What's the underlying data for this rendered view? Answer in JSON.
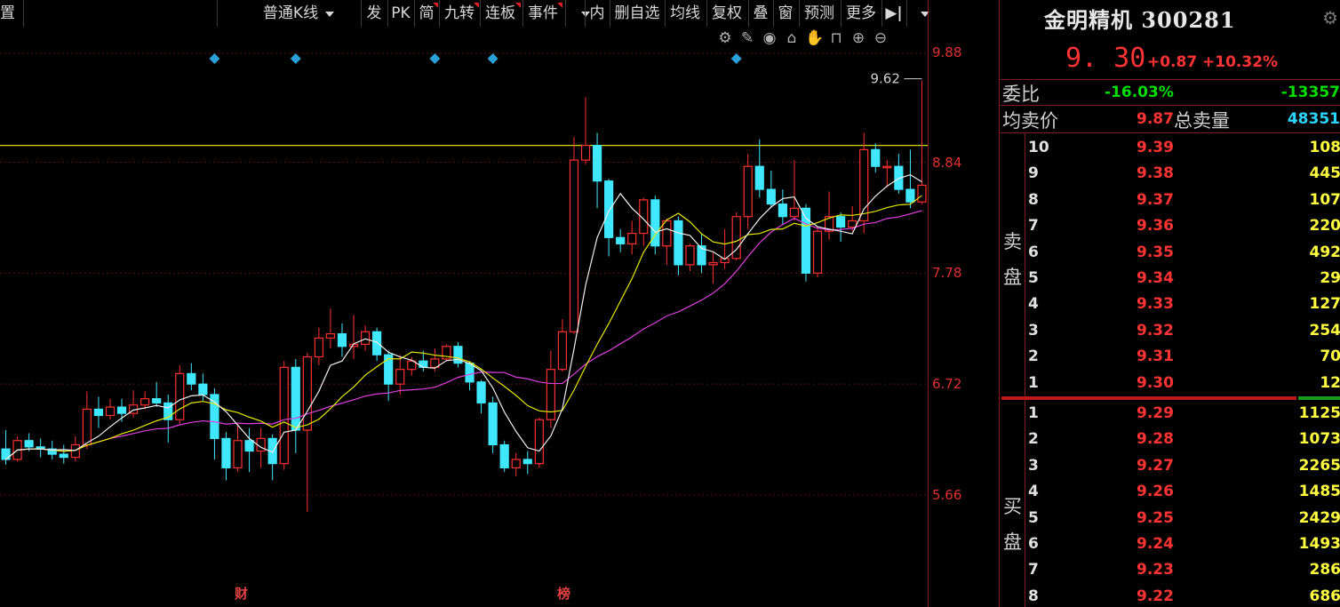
{
  "toolbar": {
    "left_cut": "置",
    "kline_type": "普通K线",
    "items": [
      "发",
      "PK",
      "简",
      "九转",
      "连板",
      "事件",
      "内",
      "删自选",
      "均线",
      "复权",
      "叠",
      "窗",
      "预测",
      "更多"
    ],
    "end_icon": "▶|"
  },
  "chart_icons": [
    "gear-icon",
    "pen-icon",
    "eye-icon",
    "lock-open-icon",
    "hand-icon",
    "lock-icon",
    "zoom-in-icon",
    "zoom-out-icon"
  ],
  "price_axis": {
    "ticks": [
      "9.88",
      "8.84",
      "7.78",
      "6.72",
      "5.66"
    ]
  },
  "x_markers": [
    {
      "label": "财"
    },
    {
      "label": "榜"
    }
  ],
  "stock": {
    "name_code": "金明精机 300281",
    "price": "9. 30",
    "change": "+0.87",
    "change_pct": "+10.32%"
  },
  "summary": {
    "weibi_label": "委比",
    "weibi_pct": "-16.03%",
    "weibi_diff": "-13357",
    "avg_sell_label": "均卖价",
    "avg_sell_price": "9.87",
    "total_sell_label": "总卖量",
    "total_sell_vol": "48351"
  },
  "sell_label": "卖盘",
  "buy_label": "买盘",
  "sell_book": [
    {
      "level": "10",
      "price": "9.39",
      "vol": "108"
    },
    {
      "level": "9",
      "price": "9.38",
      "vol": "445"
    },
    {
      "level": "8",
      "price": "9.37",
      "vol": "107"
    },
    {
      "level": "7",
      "price": "9.36",
      "vol": "220"
    },
    {
      "level": "6",
      "price": "9.35",
      "vol": "492"
    },
    {
      "level": "5",
      "price": "9.34",
      "vol": "29"
    },
    {
      "level": "4",
      "price": "9.33",
      "vol": "127"
    },
    {
      "level": "3",
      "price": "9.32",
      "vol": "254"
    },
    {
      "level": "2",
      "price": "9.31",
      "vol": "70"
    },
    {
      "level": "1",
      "price": "9.30",
      "vol": "12"
    }
  ],
  "buy_book": [
    {
      "level": "1",
      "price": "9.29",
      "vol": "1125"
    },
    {
      "level": "2",
      "price": "9.28",
      "vol": "1073"
    },
    {
      "level": "3",
      "price": "9.27",
      "vol": "2265"
    },
    {
      "level": "4",
      "price": "9.26",
      "vol": "1485"
    },
    {
      "level": "5",
      "price": "9.25",
      "vol": "2429"
    },
    {
      "level": "6",
      "price": "9.24",
      "vol": "1493"
    },
    {
      "level": "7",
      "price": "9.23",
      "vol": "286"
    },
    {
      "level": "8",
      "price": "9.22",
      "vol": "686"
    }
  ],
  "chart_data": {
    "type": "candlestick",
    "y_ticks": [
      9.88,
      8.84,
      7.78,
      6.72,
      5.66
    ],
    "ylim": [
      4.6,
      10.2
    ],
    "high_label": "9.62",
    "reference_line": 9.0,
    "colors": {
      "up": "#ff3030",
      "down": "#40e8ff",
      "ma5": "#f0f0f0",
      "ma10": "#e8e800",
      "ma20": "#e040e0",
      "ref": "#d8d800",
      "event": "#2aa0d8"
    },
    "event_marker_candles": [
      18,
      25,
      37,
      42,
      63
    ],
    "candles": [
      [
        6.1,
        6.0,
        6.28,
        5.95
      ],
      [
        6.0,
        6.18,
        6.22,
        5.98
      ],
      [
        6.18,
        6.12,
        6.25,
        6.08
      ],
      [
        6.12,
        6.1,
        6.2,
        6.02
      ],
      [
        6.1,
        6.05,
        6.18,
        6.0
      ],
      [
        6.05,
        6.02,
        6.14,
        5.96
      ],
      [
        6.02,
        6.14,
        6.22,
        5.98
      ],
      [
        6.14,
        6.48,
        6.65,
        6.1
      ],
      [
        6.48,
        6.42,
        6.6,
        6.3
      ],
      [
        6.42,
        6.5,
        6.58,
        6.38
      ],
      [
        6.5,
        6.44,
        6.58,
        6.36
      ],
      [
        6.44,
        6.52,
        6.66,
        6.4
      ],
      [
        6.52,
        6.58,
        6.65,
        6.48
      ],
      [
        6.58,
        6.54,
        6.74,
        6.5
      ],
      [
        6.54,
        6.38,
        6.62,
        6.16
      ],
      [
        6.38,
        6.82,
        6.9,
        6.34
      ],
      [
        6.82,
        6.72,
        6.92,
        6.66
      ],
      [
        6.72,
        6.62,
        6.82,
        6.56
      ],
      [
        6.62,
        6.2,
        6.68,
        6.0
      ],
      [
        6.2,
        5.92,
        6.26,
        5.8
      ],
      [
        5.92,
        6.18,
        6.34,
        5.88
      ],
      [
        6.18,
        6.08,
        6.3,
        5.88
      ],
      [
        6.08,
        6.2,
        6.3,
        5.92
      ],
      [
        6.2,
        5.96,
        6.24,
        5.8
      ],
      [
        5.96,
        6.88,
        6.94,
        5.9
      ],
      [
        6.88,
        6.28,
        6.96,
        6.06
      ],
      [
        6.28,
        6.98,
        7.02,
        5.5
      ],
      [
        6.98,
        7.16,
        7.26,
        6.9
      ],
      [
        7.16,
        7.2,
        7.44,
        7.06
      ],
      [
        7.2,
        7.08,
        7.3,
        6.98
      ],
      [
        7.08,
        7.1,
        7.38,
        6.96
      ],
      [
        7.1,
        7.22,
        7.28,
        7.04
      ],
      [
        7.22,
        7.0,
        7.26,
        6.94
      ],
      [
        7.0,
        6.72,
        7.04,
        6.56
      ],
      [
        6.72,
        6.86,
        7.0,
        6.62
      ],
      [
        6.86,
        6.94,
        6.98,
        6.8
      ],
      [
        6.94,
        6.88,
        7.04,
        6.84
      ],
      [
        6.88,
        6.96,
        7.06,
        6.84
      ],
      [
        6.96,
        7.08,
        7.1,
        6.94
      ],
      [
        7.08,
        6.92,
        7.12,
        6.88
      ],
      [
        6.92,
        6.74,
        6.94,
        6.66
      ],
      [
        6.74,
        6.54,
        6.76,
        6.44
      ],
      [
        6.54,
        6.14,
        6.6,
        6.06
      ],
      [
        6.14,
        5.92,
        6.18,
        5.88
      ],
      [
        5.92,
        6.0,
        6.06,
        5.84
      ],
      [
        6.0,
        5.96,
        6.08,
        5.86
      ],
      [
        5.96,
        6.38,
        6.4,
        5.92
      ],
      [
        6.38,
        6.86,
        7.04,
        6.3
      ],
      [
        6.86,
        7.22,
        7.34,
        6.84
      ],
      [
        7.22,
        8.86,
        9.08,
        7.2
      ],
      [
        8.86,
        9.0,
        9.46,
        8.82
      ],
      [
        9.0,
        8.66,
        9.12,
        8.4
      ],
      [
        8.66,
        8.12,
        8.68,
        7.94
      ],
      [
        8.12,
        8.06,
        8.2,
        7.98
      ],
      [
        8.06,
        8.16,
        8.28,
        7.96
      ],
      [
        8.16,
        8.48,
        8.5,
        8.04
      ],
      [
        8.48,
        8.04,
        8.52,
        7.96
      ],
      [
        8.04,
        8.28,
        8.3,
        7.86
      ],
      [
        8.28,
        7.86,
        8.32,
        7.76
      ],
      [
        7.86,
        8.04,
        8.06,
        7.8
      ],
      [
        8.04,
        7.86,
        8.16,
        7.78
      ],
      [
        7.86,
        7.88,
        7.98,
        7.68
      ],
      [
        7.88,
        7.92,
        8.2,
        7.82
      ],
      [
        7.92,
        8.32,
        8.36,
        7.9
      ],
      [
        8.32,
        8.8,
        8.92,
        8.2
      ],
      [
        8.8,
        8.58,
        9.06,
        8.5
      ],
      [
        8.58,
        8.44,
        8.76,
        8.4
      ],
      [
        8.44,
        8.32,
        8.58,
        8.24
      ],
      [
        8.32,
        8.4,
        8.86,
        8.28
      ],
      [
        8.4,
        7.78,
        8.44,
        7.7
      ],
      [
        7.78,
        8.18,
        8.22,
        7.74
      ],
      [
        8.18,
        8.32,
        8.56,
        8.1
      ],
      [
        8.32,
        8.22,
        8.36,
        8.08
      ],
      [
        8.22,
        8.28,
        8.42,
        8.18
      ],
      [
        8.28,
        8.96,
        9.12,
        8.16
      ],
      [
        8.96,
        8.8,
        9.02,
        8.74
      ],
      [
        8.8,
        8.8,
        8.86,
        8.6
      ],
      [
        8.8,
        8.58,
        8.92,
        8.54
      ],
      [
        8.58,
        8.46,
        8.96,
        8.4
      ],
      [
        8.46,
        8.62,
        9.62,
        8.44
      ]
    ]
  }
}
